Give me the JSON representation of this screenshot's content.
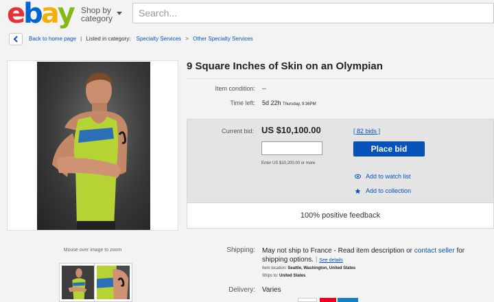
{
  "header": {
    "logo_letters": [
      "e",
      "b",
      "a",
      "y"
    ],
    "logo_colors": [
      "#e53238",
      "#0064d2",
      "#f5af02",
      "#86b817"
    ],
    "shop_by_line1": "Shop by",
    "shop_by_line2": "category",
    "search_placeholder": "Search..."
  },
  "breadcrumb": {
    "back_label": "Back to home page",
    "listed_label": "Listed in category:",
    "category1": "Specialty Services",
    "separator": ">",
    "category2": "Other Specialty Services"
  },
  "gallery": {
    "zoom_hint": "Mouse over image to zoom",
    "thumbnail_count": 2
  },
  "item": {
    "title": "9 Square Inches of Skin on an Olympian",
    "condition_label": "Item condition:",
    "condition_value": "--",
    "time_left_label": "Time left:",
    "time_left_value": "5d 22h",
    "time_left_detail": "Thursday, 9:36PM"
  },
  "bid": {
    "current_bid_label": "Current bid:",
    "current_bid_value": "US $10,100.00",
    "bids_count_link": "[ 82 bids ]",
    "input_value": "",
    "place_bid_label": "Place bid",
    "enter_hint": "Enter US $10,200.00 or more",
    "watch_list_label": "Add to watch list",
    "collection_label": "Add to collection",
    "feedback": "100% positive feedback"
  },
  "shipping": {
    "shipping_label": "Shipping:",
    "line_text": "May not ship to France - Read item description or",
    "contact_link": "contact seller",
    "line_text2": "for shipping options.",
    "see_details": "See details",
    "item_location_label": "Item location:",
    "item_location_value": "Seattle, Washington, United States",
    "ships_to_label": "Ships to:",
    "ships_to_value": "United States",
    "delivery_label": "Delivery:",
    "delivery_value": "Varies"
  },
  "colors": {
    "link_blue": "#0654ba",
    "button_blue": "#0654ba",
    "singlet_green": "#b5d334"
  }
}
